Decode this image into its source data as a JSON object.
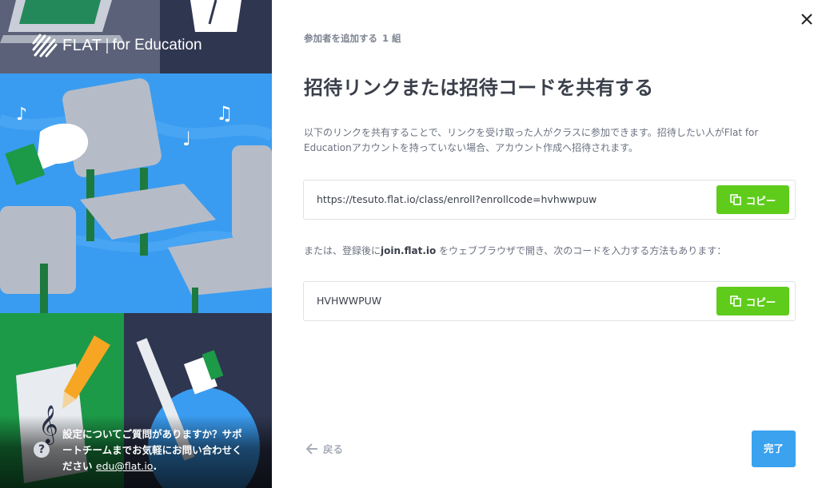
{
  "brand": {
    "name": "FLAT",
    "separator": "|",
    "suffix": "for Education"
  },
  "help": {
    "text": "設定についてご質問がありますか？サポートチームまでお気軽にお問い合わせください",
    "email": "edu@flat.io",
    "tail": "."
  },
  "header": {
    "step_label": "参加者を追加する",
    "step_count": "1 組",
    "title": "招待リンクまたは招待コードを共有する",
    "description": "以下のリンクを共有することで、リンクを受け取った人がクラスに参加できます。招待したい人がFlat for Educationアカウントを持っていない場合、アカウント作成へ招待されます。"
  },
  "invite_link": {
    "value": "https://tesuto.flat.io/class/enroll?enrollcode=hvhwwpuw",
    "copy_label": "コピー"
  },
  "alternative": {
    "prefix": "または、登録後に",
    "site": "join.flat.io",
    "suffix": " をウェブブラウザで開き、次のコードを入力する方法もあります："
  },
  "invite_code": {
    "value": "HVHWWPUW",
    "copy_label": "コピー"
  },
  "footer": {
    "back_label": "戻る",
    "done_label": "完了"
  },
  "icons": {
    "close": "close-icon",
    "copy": "copy-icon",
    "back": "arrow-left-icon",
    "help": "question-icon"
  },
  "colors": {
    "copy_button": "#5fcc1b",
    "done_button": "#3aa2ef",
    "panel_blue": "#3a9cf0",
    "panel_green": "#1c9a48",
    "panel_navy": "#2f3650"
  }
}
